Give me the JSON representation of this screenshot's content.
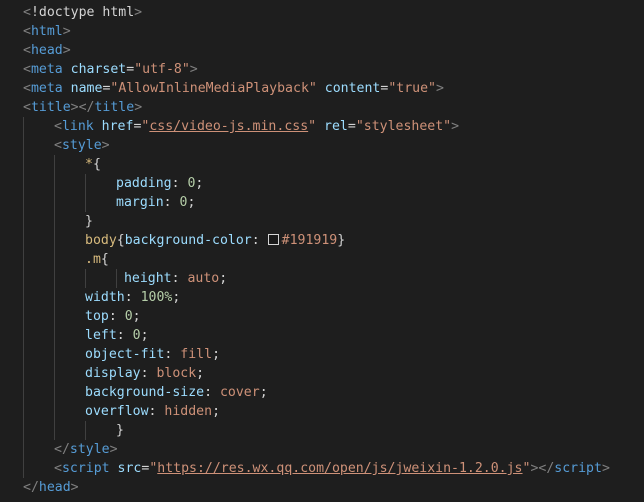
{
  "editor": {
    "lines": [
      {
        "indent": 0,
        "tokens": [
          [
            "punc",
            "<"
          ],
          [
            "text",
            "!doctype html"
          ],
          [
            "punc",
            ">"
          ]
        ]
      },
      {
        "indent": 0,
        "tokens": [
          [
            "punc",
            "<"
          ],
          [
            "tag",
            "html"
          ],
          [
            "punc",
            ">"
          ]
        ]
      },
      {
        "indent": 0,
        "tokens": [
          [
            "punc",
            "<"
          ],
          [
            "tag",
            "head"
          ],
          [
            "punc",
            ">"
          ]
        ]
      },
      {
        "indent": 0,
        "tokens": [
          [
            "punc",
            "<"
          ],
          [
            "tag",
            "meta"
          ],
          [
            "text",
            " "
          ],
          [
            "attr",
            "charset"
          ],
          [
            "text",
            "="
          ],
          [
            "str",
            "\"utf-8\""
          ],
          [
            "punc",
            ">"
          ]
        ]
      },
      {
        "indent": 0,
        "tokens": [
          [
            "punc",
            "<"
          ],
          [
            "tag",
            "meta"
          ],
          [
            "text",
            " "
          ],
          [
            "attr",
            "name"
          ],
          [
            "text",
            "="
          ],
          [
            "str",
            "\"AllowInlineMediaPlayback\""
          ],
          [
            "text",
            " "
          ],
          [
            "attr",
            "content"
          ],
          [
            "text",
            "="
          ],
          [
            "str",
            "\"true\""
          ],
          [
            "punc",
            ">"
          ]
        ]
      },
      {
        "indent": 0,
        "tokens": [
          [
            "punc",
            "<"
          ],
          [
            "tag",
            "title"
          ],
          [
            "punc",
            "></"
          ],
          [
            "tag",
            "title"
          ],
          [
            "punc",
            ">"
          ]
        ]
      },
      {
        "indent": 1,
        "tokens": [
          [
            "punc",
            "<"
          ],
          [
            "tag",
            "link"
          ],
          [
            "text",
            " "
          ],
          [
            "attr",
            "href"
          ],
          [
            "text",
            "="
          ],
          [
            "str",
            "\""
          ],
          [
            "str link",
            "css/video-js.min.css"
          ],
          [
            "str",
            "\""
          ],
          [
            "text",
            " "
          ],
          [
            "attr",
            "rel"
          ],
          [
            "text",
            "="
          ],
          [
            "str",
            "\"stylesheet\""
          ],
          [
            "punc",
            ">"
          ]
        ]
      },
      {
        "indent": 1,
        "tokens": [
          [
            "punc",
            "<"
          ],
          [
            "tag",
            "style"
          ],
          [
            "punc",
            ">"
          ]
        ]
      },
      {
        "indent": 2,
        "tokens": [
          [
            "sel",
            "*"
          ],
          [
            "text",
            "{"
          ]
        ]
      },
      {
        "indent": 3,
        "tokens": [
          [
            "prop",
            "padding"
          ],
          [
            "text",
            ": "
          ],
          [
            "num",
            "0"
          ],
          [
            "text",
            ";"
          ]
        ]
      },
      {
        "indent": 3,
        "tokens": [
          [
            "prop",
            "margin"
          ],
          [
            "text",
            ": "
          ],
          [
            "num",
            "0"
          ],
          [
            "text",
            ";"
          ]
        ]
      },
      {
        "indent": 2,
        "tokens": [
          [
            "text",
            "}"
          ]
        ]
      },
      {
        "indent": 2,
        "tokens": [
          [
            "sel",
            "body"
          ],
          [
            "text",
            "{"
          ],
          [
            "prop",
            "background-color"
          ],
          [
            "text",
            ": "
          ],
          [
            "swatch",
            ""
          ],
          [
            "val",
            "#191919"
          ],
          [
            "text",
            "}"
          ]
        ]
      },
      {
        "indent": 2,
        "tokens": [
          [
            "sel",
            ".m"
          ],
          [
            "text",
            "{"
          ]
        ]
      },
      {
        "indent": 3,
        "extra": 1,
        "tokens": [
          [
            "text",
            " "
          ],
          [
            "prop",
            "height"
          ],
          [
            "text",
            ": "
          ],
          [
            "val",
            "auto"
          ],
          [
            "text",
            ";"
          ]
        ]
      },
      {
        "indent": 2,
        "tokens": [
          [
            "prop",
            "width"
          ],
          [
            "text",
            ": "
          ],
          [
            "num",
            "100%"
          ],
          [
            "text",
            ";"
          ]
        ]
      },
      {
        "indent": 2,
        "tokens": [
          [
            "prop",
            "top"
          ],
          [
            "text",
            ": "
          ],
          [
            "num",
            "0"
          ],
          [
            "text",
            ";"
          ]
        ]
      },
      {
        "indent": 2,
        "tokens": [
          [
            "prop",
            "left"
          ],
          [
            "text",
            ": "
          ],
          [
            "num",
            "0"
          ],
          [
            "text",
            ";"
          ]
        ]
      },
      {
        "indent": 2,
        "tokens": [
          [
            "prop",
            "object-fit"
          ],
          [
            "text",
            ": "
          ],
          [
            "val",
            "fill"
          ],
          [
            "text",
            ";"
          ]
        ]
      },
      {
        "indent": 2,
        "tokens": [
          [
            "prop",
            "display"
          ],
          [
            "text",
            ": "
          ],
          [
            "val",
            "block"
          ],
          [
            "text",
            ";"
          ]
        ]
      },
      {
        "indent": 2,
        "tokens": [
          [
            "prop",
            "background-size"
          ],
          [
            "text",
            ": "
          ],
          [
            "val",
            "cover"
          ],
          [
            "text",
            ";"
          ]
        ]
      },
      {
        "indent": 2,
        "tokens": [
          [
            "prop",
            "overflow"
          ],
          [
            "text",
            ": "
          ],
          [
            "val",
            "hidden"
          ],
          [
            "text",
            ";"
          ]
        ]
      },
      {
        "indent": 3,
        "tokens": [
          [
            "text",
            "}"
          ]
        ]
      },
      {
        "indent": 1,
        "tokens": [
          [
            "punc",
            "</"
          ],
          [
            "tag",
            "style"
          ],
          [
            "punc",
            ">"
          ]
        ]
      },
      {
        "indent": 1,
        "tokens": [
          [
            "punc",
            "<"
          ],
          [
            "tag",
            "script"
          ],
          [
            "text",
            " "
          ],
          [
            "attr",
            "src"
          ],
          [
            "text",
            "="
          ],
          [
            "str",
            "\""
          ],
          [
            "str link",
            "https://res.wx.qq.com/open/js/jweixin-1.2.0.js"
          ],
          [
            "str",
            "\""
          ],
          [
            "punc",
            "></"
          ],
          [
            "tag",
            "script"
          ],
          [
            "punc",
            ">"
          ]
        ]
      },
      {
        "indent": 0,
        "tokens": [
          [
            "punc",
            "</"
          ],
          [
            "tag",
            "head"
          ],
          [
            "punc",
            ">"
          ]
        ]
      }
    ]
  },
  "colors": {
    "background": "#1e1e1e",
    "tag": "#569cd6",
    "attribute": "#9cdcfe",
    "string": "#ce9178",
    "selector": "#d7ba7d",
    "number": "#b5cea8",
    "swatch": "#191919"
  }
}
